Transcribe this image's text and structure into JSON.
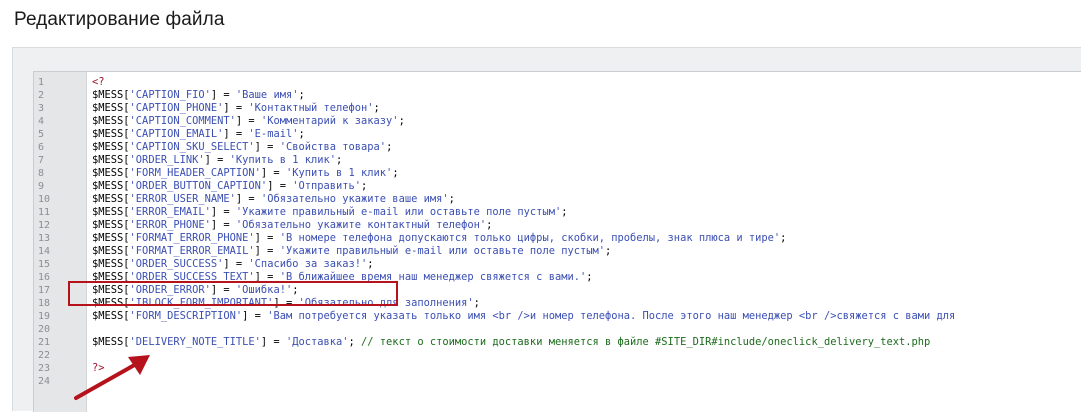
{
  "page": {
    "title": "Редактирование файла"
  },
  "colors": {
    "string": "#3b4fb3",
    "comment": "#1c6b1c",
    "php_tag": "#a0152c",
    "highlight": "#b5121b"
  },
  "editor": {
    "lines": [
      {
        "num": "1",
        "tokens": [
          {
            "t": "<?",
            "c": "tag"
          }
        ]
      },
      {
        "num": "2",
        "tokens": [
          {
            "t": "$MESS[",
            "c": "var"
          },
          {
            "t": "'CAPTION_FIO'",
            "c": "str"
          },
          {
            "t": "] = ",
            "c": "op"
          },
          {
            "t": "'Ваше имя'",
            "c": "str"
          },
          {
            "t": ";",
            "c": "op"
          }
        ]
      },
      {
        "num": "3",
        "tokens": [
          {
            "t": "$MESS[",
            "c": "var"
          },
          {
            "t": "'CAPTION_PHONE'",
            "c": "str"
          },
          {
            "t": "] = ",
            "c": "op"
          },
          {
            "t": "'Контактный телефон'",
            "c": "str"
          },
          {
            "t": ";",
            "c": "op"
          }
        ]
      },
      {
        "num": "4",
        "tokens": [
          {
            "t": "$MESS[",
            "c": "var"
          },
          {
            "t": "'CAPTION_COMMENT'",
            "c": "str"
          },
          {
            "t": "] = ",
            "c": "op"
          },
          {
            "t": "'Комментарий к заказу'",
            "c": "str"
          },
          {
            "t": ";",
            "c": "op"
          }
        ]
      },
      {
        "num": "5",
        "tokens": [
          {
            "t": "$MESS[",
            "c": "var"
          },
          {
            "t": "'CAPTION_EMAIL'",
            "c": "str"
          },
          {
            "t": "] = ",
            "c": "op"
          },
          {
            "t": "'E-mail'",
            "c": "str"
          },
          {
            "t": ";",
            "c": "op"
          }
        ]
      },
      {
        "num": "6",
        "tokens": [
          {
            "t": "$MESS[",
            "c": "var"
          },
          {
            "t": "'CAPTION_SKU_SELECT'",
            "c": "str"
          },
          {
            "t": "] = ",
            "c": "op"
          },
          {
            "t": "'Свойства товара'",
            "c": "str"
          },
          {
            "t": ";",
            "c": "op"
          }
        ]
      },
      {
        "num": "7",
        "tokens": [
          {
            "t": "$MESS[",
            "c": "var"
          },
          {
            "t": "'ORDER_LINK'",
            "c": "str"
          },
          {
            "t": "] = ",
            "c": "op"
          },
          {
            "t": "'Купить в 1 клик'",
            "c": "str"
          },
          {
            "t": ";",
            "c": "op"
          }
        ]
      },
      {
        "num": "8",
        "tokens": [
          {
            "t": "$MESS[",
            "c": "var"
          },
          {
            "t": "'FORM_HEADER_CAPTION'",
            "c": "str"
          },
          {
            "t": "] = ",
            "c": "op"
          },
          {
            "t": "'Купить в 1 клик'",
            "c": "str"
          },
          {
            "t": ";",
            "c": "op"
          }
        ]
      },
      {
        "num": "9",
        "tokens": [
          {
            "t": "$MESS[",
            "c": "var"
          },
          {
            "t": "'ORDER_BUTTON_CAPTION'",
            "c": "str"
          },
          {
            "t": "] = ",
            "c": "op"
          },
          {
            "t": "'Отправить'",
            "c": "str"
          },
          {
            "t": ";",
            "c": "op"
          }
        ]
      },
      {
        "num": "10",
        "tokens": [
          {
            "t": "$MESS[",
            "c": "var"
          },
          {
            "t": "'ERROR_USER_NAME'",
            "c": "str"
          },
          {
            "t": "] = ",
            "c": "op"
          },
          {
            "t": "'Обязательно укажите ваше имя'",
            "c": "str"
          },
          {
            "t": ";",
            "c": "op"
          }
        ]
      },
      {
        "num": "11",
        "tokens": [
          {
            "t": "$MESS[",
            "c": "var"
          },
          {
            "t": "'ERROR_EMAIL'",
            "c": "str"
          },
          {
            "t": "] = ",
            "c": "op"
          },
          {
            "t": "'Укажите правильный e-mail или оставьте поле пустым'",
            "c": "str"
          },
          {
            "t": ";",
            "c": "op"
          }
        ]
      },
      {
        "num": "12",
        "tokens": [
          {
            "t": "$MESS[",
            "c": "var"
          },
          {
            "t": "'ERROR_PHONE'",
            "c": "str"
          },
          {
            "t": "] = ",
            "c": "op"
          },
          {
            "t": "'Обязательно укажите контактный телефон'",
            "c": "str"
          },
          {
            "t": ";",
            "c": "op"
          }
        ]
      },
      {
        "num": "13",
        "tokens": [
          {
            "t": "$MESS[",
            "c": "var"
          },
          {
            "t": "'FORMAT_ERROR_PHONE'",
            "c": "str"
          },
          {
            "t": "] = ",
            "c": "op"
          },
          {
            "t": "'В номере телефона допускаются только цифры, скобки, пробелы, знак плюса и тире'",
            "c": "str"
          },
          {
            "t": ";",
            "c": "op"
          }
        ]
      },
      {
        "num": "14",
        "tokens": [
          {
            "t": "$MESS[",
            "c": "var"
          },
          {
            "t": "'FORMAT_ERROR_EMAIL'",
            "c": "str"
          },
          {
            "t": "] = ",
            "c": "op"
          },
          {
            "t": "'Укажите правильный e-mail или оставьте поле пустым'",
            "c": "str"
          },
          {
            "t": ";",
            "c": "op"
          }
        ]
      },
      {
        "num": "15",
        "tokens": [
          {
            "t": "$MESS[",
            "c": "var"
          },
          {
            "t": "'ORDER_SUCCESS'",
            "c": "str"
          },
          {
            "t": "] = ",
            "c": "op"
          },
          {
            "t": "'Спасибо за заказ!'",
            "c": "str"
          },
          {
            "t": ";",
            "c": "op"
          }
        ]
      },
      {
        "num": "16",
        "tokens": [
          {
            "t": "$MESS[",
            "c": "var"
          },
          {
            "t": "'ORDER_SUCCESS_TEXT'",
            "c": "str"
          },
          {
            "t": "] = ",
            "c": "op"
          },
          {
            "t": "'В ближайшее время наш менеджер свяжется с вами.'",
            "c": "str"
          },
          {
            "t": ";",
            "c": "op"
          }
        ]
      },
      {
        "num": "17",
        "tokens": [
          {
            "t": "$MESS[",
            "c": "var"
          },
          {
            "t": "'ORDER_ERROR'",
            "c": "str"
          },
          {
            "t": "] = ",
            "c": "op"
          },
          {
            "t": "'Ошибка!'",
            "c": "str"
          },
          {
            "t": ";",
            "c": "op"
          }
        ]
      },
      {
        "num": "18",
        "tokens": [
          {
            "t": "$MESS[",
            "c": "var"
          },
          {
            "t": "'IBLOCK_FORM_IMPORTANT'",
            "c": "str"
          },
          {
            "t": "] = ",
            "c": "op"
          },
          {
            "t": "'Обязательно для заполнения'",
            "c": "str"
          },
          {
            "t": ";",
            "c": "op"
          }
        ]
      },
      {
        "num": "19",
        "tokens": [
          {
            "t": "$MESS[",
            "c": "var"
          },
          {
            "t": "'FORM_DESCRIPTION'",
            "c": "str"
          },
          {
            "t": "] = ",
            "c": "op"
          },
          {
            "t": "'Вам потребуется указать только имя <br />и номер телефона. После этого наш менеджер <br />свяжется с вами для",
            "c": "str"
          }
        ]
      },
      {
        "num": "20",
        "tokens": []
      },
      {
        "num": "21",
        "tokens": [
          {
            "t": "$MESS[",
            "c": "var"
          },
          {
            "t": "'DELIVERY_NOTE_TITLE'",
            "c": "str"
          },
          {
            "t": "] = ",
            "c": "op"
          },
          {
            "t": "'Доставка'",
            "c": "str"
          },
          {
            "t": "; ",
            "c": "op"
          },
          {
            "t": "// текст о стоимости доставки меняется в файле #SITE_DIR#include/oneclick_delivery_text.php",
            "c": "cmt"
          }
        ]
      },
      {
        "num": "22",
        "tokens": []
      },
      {
        "num": "23",
        "tokens": [
          {
            "t": "?>",
            "c": "tag"
          }
        ]
      },
      {
        "num": "24",
        "tokens": []
      }
    ]
  }
}
